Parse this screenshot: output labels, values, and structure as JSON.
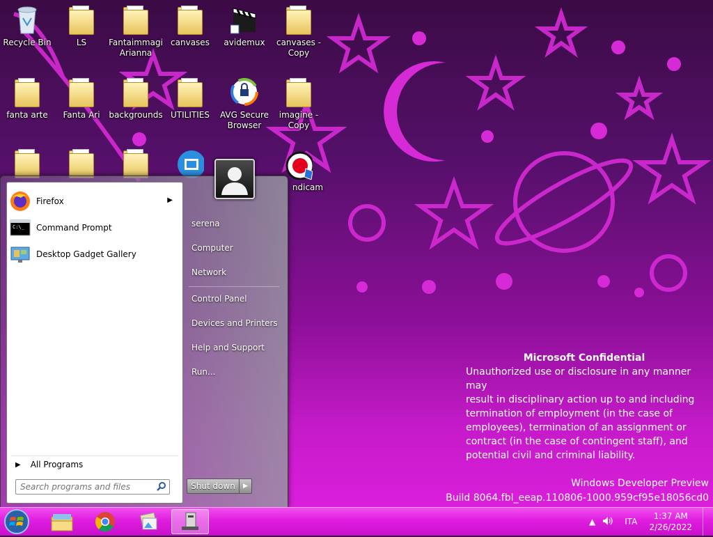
{
  "desktop": {
    "icons": [
      {
        "label": "Recycle Bin",
        "icon": "recycle-bin-icon"
      },
      {
        "label": "LS",
        "icon": "folder-icon"
      },
      {
        "label": "Fantaimmagi Arianna",
        "icon": "folder-icon"
      },
      {
        "label": "canvases",
        "icon": "folder-icon"
      },
      {
        "label": "avidemux",
        "icon": "avidemux-icon"
      },
      {
        "label": "canvases - Copy",
        "icon": "folder-icon"
      },
      {
        "label": "fanta arte",
        "icon": "folder-icon"
      },
      {
        "label": "Fanta Ari",
        "icon": "folder-icon"
      },
      {
        "label": "backgrounds",
        "icon": "folder-icon"
      },
      {
        "label": "UTILITIES",
        "icon": "folder-icon"
      },
      {
        "label": "AVG Secure Browser",
        "icon": "avg-browser-icon"
      },
      {
        "label": "imagine - Copy",
        "icon": "folder-icon"
      },
      {
        "label": "ndicam",
        "icon": "bandicam-icon"
      }
    ],
    "watermark": {
      "title": "Microsoft Confidential",
      "lines": [
        "Unauthorized use or disclosure in any manner may",
        "result in disciplinary action up to and including",
        "termination of employment (in the case of",
        "employees), termination of an assignment or",
        "contract (in the case of contingent staff), and",
        "potential civil and criminal liability."
      ]
    },
    "build": {
      "edition": "Windows Developer Preview",
      "number": "Build 8064.fbl_eeap.110806-1000.959cf95e18056cd0"
    }
  },
  "start_menu": {
    "programs": [
      {
        "label": "Firefox",
        "icon": "firefox-icon",
        "has_submenu": true
      },
      {
        "label": "Command Prompt",
        "icon": "command-prompt-icon",
        "has_submenu": false
      },
      {
        "label": "Desktop Gadget Gallery",
        "icon": "gadget-gallery-icon",
        "has_submenu": false
      }
    ],
    "all_programs": "All Programs",
    "search_placeholder": "Search programs and files",
    "places": [
      "serena",
      "Computer",
      "Network",
      "Control Panel",
      "Devices and Printers",
      "Help and Support",
      "Run..."
    ],
    "shutdown_label": "Shut down"
  },
  "taskbar": {
    "pinned": [
      "windows-explorer-icon",
      "chrome-icon",
      "photos-icon",
      "application-icon"
    ],
    "tray": {
      "language": "ITA",
      "time": "1:37 AM",
      "date": "2/26/2022"
    }
  },
  "colors": {
    "taskbar": "#e01ee0",
    "wallpaper_dark": "#3b0b45",
    "wallpaper_accent": "#e02ae0"
  }
}
